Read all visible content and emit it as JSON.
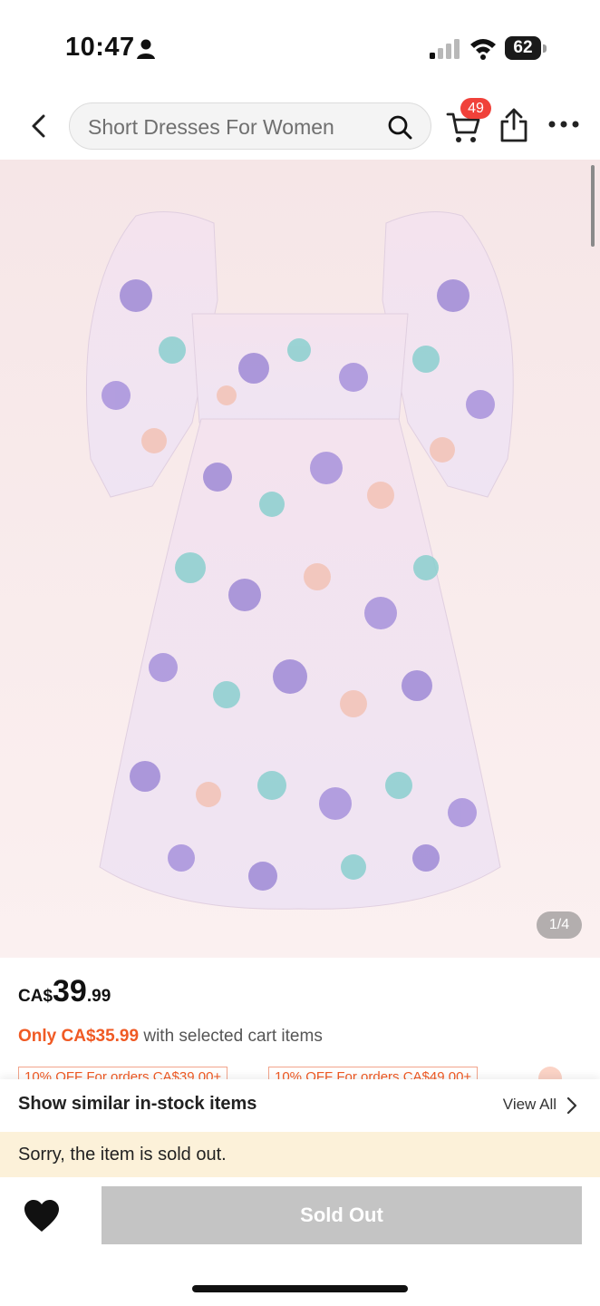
{
  "status_bar": {
    "time": "10:47",
    "battery": "62",
    "icons": [
      "person-icon",
      "signal-icon",
      "wifi-icon",
      "battery-icon"
    ]
  },
  "nav": {
    "search_text": "Short Dresses For Women",
    "cart_count": "49",
    "icons": [
      "back-icon",
      "search-icon",
      "cart-icon",
      "share-icon",
      "more-icon"
    ]
  },
  "gallery": {
    "page_indicator": "1/4"
  },
  "price": {
    "currency": "CA$",
    "whole": "39",
    "cents": ".99"
  },
  "promo": {
    "only_text": "Only CA$35.99",
    "rest_text": " with selected cart items"
  },
  "coupons": [
    "10% OFF For orders CA$39.00+",
    "10% OFF For orders CA$49.00+"
  ],
  "similar": {
    "title": "Show similar in-stock items",
    "view_all": "View All"
  },
  "notice": {
    "text": "Sorry, the item is sold out."
  },
  "actions": {
    "sold_out_label": "Sold Out"
  },
  "colors": {
    "accent_orange": "#f05a24",
    "badge_red": "#f0413a",
    "notice_bg": "#fcf1d9",
    "disabled_button": "#c4c4c4",
    "gallery_bg": "#f6e6e7"
  }
}
